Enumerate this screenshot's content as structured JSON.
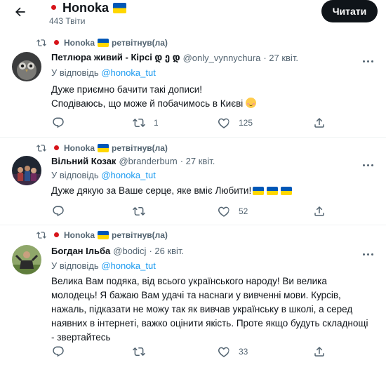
{
  "header": {
    "title": "Honoka",
    "tweet_count": "443 Твіти",
    "read_button": "Читати"
  },
  "colors": {
    "accent": "#1d9bf0",
    "muted": "#536471",
    "text": "#0f1419"
  },
  "tweets": [
    {
      "retweeter": "Honoka",
      "retweet_label": "ретвітнув(ла)",
      "name": "Петлюра живий - Кірсі დ ე დ",
      "handle": "@only_vynnychura",
      "date": "· 27 квіт.",
      "reply_prefix": "У відповідь",
      "reply_to": "@honoka_tut",
      "lines": [
        "Дуже приємно бачити такі дописи!",
        "Сподіваюсь, що може й побачимось в Києві"
      ],
      "retweets": "1",
      "likes": "125"
    },
    {
      "retweeter": "Honoka",
      "retweet_label": "ретвітнув(ла)",
      "name": "Вільний Козак",
      "handle": "@branderbum",
      "date": "· 27 квіт.",
      "reply_prefix": "У відповідь",
      "reply_to": "@honoka_tut",
      "lines": [
        "Дуже дякую за Ваше серце, яке вміє Любити!"
      ],
      "retweets": "",
      "likes": "52"
    },
    {
      "retweeter": "Honoka",
      "retweet_label": "ретвітнув(ла)",
      "name": "Богдан Ільба",
      "handle": "@bodicj",
      "date": "· 26 квіт.",
      "reply_prefix": "У відповідь",
      "reply_to": "@honoka_tut",
      "lines": [
        "Велика Вам подяка, від всього українського народу! Ви велика",
        "молодець! Я бажаю Вам удачі та наснаги у вивченні мови. Курсів,",
        "нажаль, підказати не можу так як вивчав українську в школі, а серед",
        "наявних в інтернеті, важко оцінити якість. Проте якщо будуть складнощі",
        "- звертайтесь"
      ],
      "retweets": "",
      "likes": "33"
    }
  ]
}
